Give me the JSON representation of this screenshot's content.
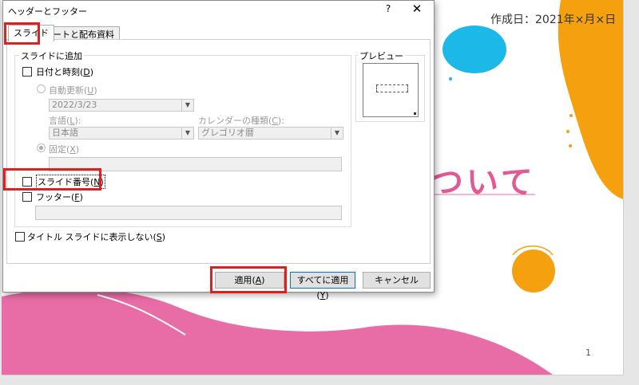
{
  "slide": {
    "date_text": "作成日：2021年×月×日",
    "title_fragment": "ついて",
    "page_number": "1"
  },
  "dialog": {
    "title": "ヘッダーとフッター",
    "help_glyph": "?",
    "close_glyph": "✕",
    "tabs": [
      {
        "label": "スライド",
        "active": true
      },
      {
        "label": "ノートと配布資料",
        "active": false
      }
    ],
    "group_label": "スライドに追加",
    "date_time": {
      "label": "日付と時刻",
      "accesskey": "D",
      "checked": false
    },
    "auto_update": {
      "label": "自動更新",
      "accesskey": "U",
      "selected": false
    },
    "date_value": "2022/3/23",
    "language": {
      "label": "言語",
      "accesskey": "L",
      "value": "日本語"
    },
    "calendar": {
      "label": "カレンダーの種類",
      "accesskey": "C",
      "value": "グレゴリオ暦"
    },
    "fixed": {
      "label": "固定",
      "accesskey": "X",
      "selected": true,
      "value": ""
    },
    "slide_number": {
      "label": "スライド番号",
      "accesskey": "N",
      "checked": false
    },
    "footer": {
      "label": "フッター",
      "accesskey": "F",
      "checked": false,
      "value": ""
    },
    "no_title_slide": {
      "label": "タイトル スライドに表示しない",
      "accesskey": "S",
      "checked": false
    },
    "preview_label": "プレビュー",
    "buttons": {
      "apply": {
        "label": "適用",
        "accesskey": "A"
      },
      "apply_all": {
        "label": "すべてに適用",
        "accesskey": "Y"
      },
      "cancel": "キャンセル"
    }
  },
  "colors": {
    "highlight": "#e02020",
    "pink": "#e86ca5",
    "orange": "#f5a00f",
    "cyan": "#1cb8e8"
  }
}
